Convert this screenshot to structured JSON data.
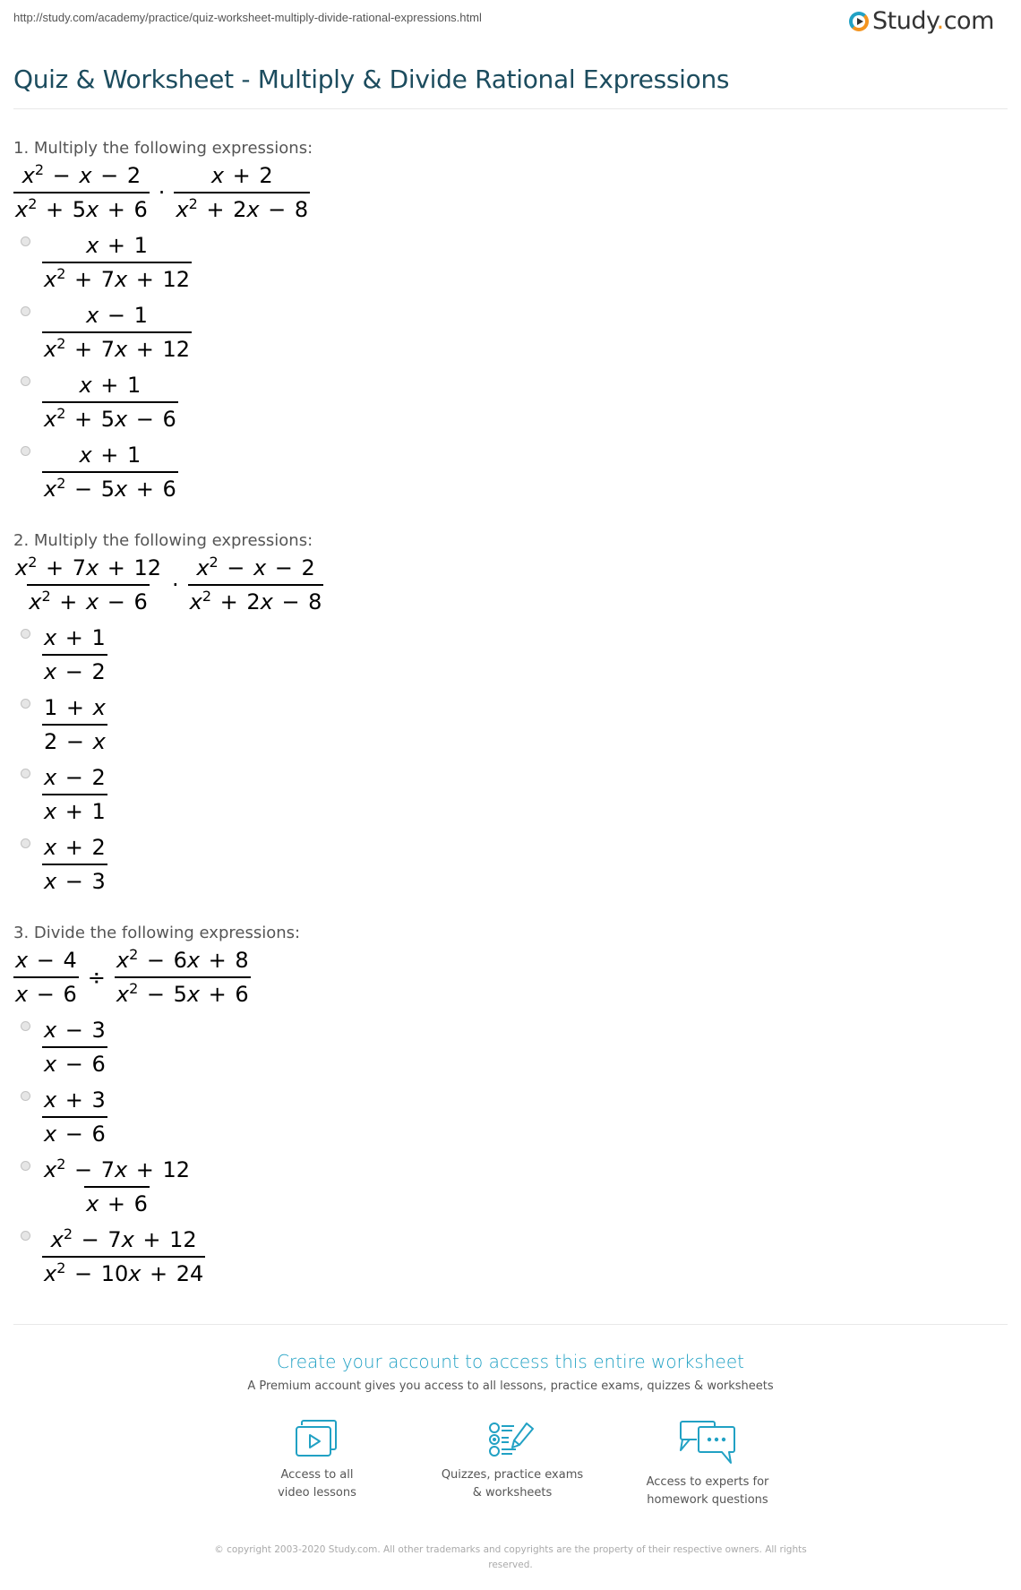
{
  "page": {
    "url": "http://study.com/academy/practice/quiz-worksheet-multiply-divide-rational-expressions.html",
    "logo": {
      "text": "Study",
      "dot": ".",
      "tld": "com"
    },
    "title": "Quiz & Worksheet - Multiply & Divide Rational Expressions"
  },
  "questions": [
    {
      "heading": "1. Multiply the following expressions:",
      "operator": "·",
      "left": {
        "num": "x² − x − 2",
        "den": "x² + 5x + 6"
      },
      "right": {
        "num": "x + 2",
        "den": "x² + 2x − 8"
      },
      "options": [
        {
          "num": "x + 1",
          "den": "x² + 7x + 12"
        },
        {
          "num": "x − 1",
          "den": "x² + 7x + 12"
        },
        {
          "num": "x + 1",
          "den": "x² + 5x − 6"
        },
        {
          "num": "x + 1",
          "den": "x² − 5x + 6"
        }
      ]
    },
    {
      "heading": "2. Multiply the following expressions:",
      "operator": "·",
      "left": {
        "num": "x² + 7x + 12",
        "den": "x² + x − 6"
      },
      "right": {
        "num": "x² − x − 2",
        "den": "x² + 2x − 8"
      },
      "options": [
        {
          "num": "x + 1",
          "den": "x − 2"
        },
        {
          "num": "1 + x",
          "den": "2 − x"
        },
        {
          "num": "x − 2",
          "den": "x + 1"
        },
        {
          "num": "x + 2",
          "den": "x − 3"
        }
      ]
    },
    {
      "heading": "3. Divide the following expressions:",
      "operator": "÷",
      "left": {
        "num": "x − 4",
        "den": "x − 6"
      },
      "right": {
        "num": "x² − 6x + 8",
        "den": "x² − 5x + 6"
      },
      "options": [
        {
          "num": "x − 3",
          "den": "x − 6"
        },
        {
          "num": "x + 3",
          "den": "x − 6"
        },
        {
          "num": "x² − 7x + 12",
          "den": "x + 6"
        },
        {
          "num": "x² − 7x + 12",
          "den": "x² − 10x + 24"
        }
      ]
    }
  ],
  "cta": {
    "title": "Create your account to access this entire worksheet",
    "subtitle": "A Premium account gives you access to all lessons, practice exams, quizzes & worksheets",
    "features": [
      {
        "icon": "video-lessons-icon",
        "line1": "Access to all",
        "line2": "video lessons"
      },
      {
        "icon": "quiz-checklist-icon",
        "line1": "Quizzes, practice exams",
        "line2": "& worksheets"
      },
      {
        "icon": "chat-bubbles-icon",
        "line1": "Access to experts for",
        "line2": "homework questions"
      }
    ],
    "accent_color": "#21a1c4"
  },
  "footer": {
    "copyright": "© copyright 2003-2020 Study.com. All other trademarks and copyrights are the property of their respective owners. All rights reserved."
  }
}
